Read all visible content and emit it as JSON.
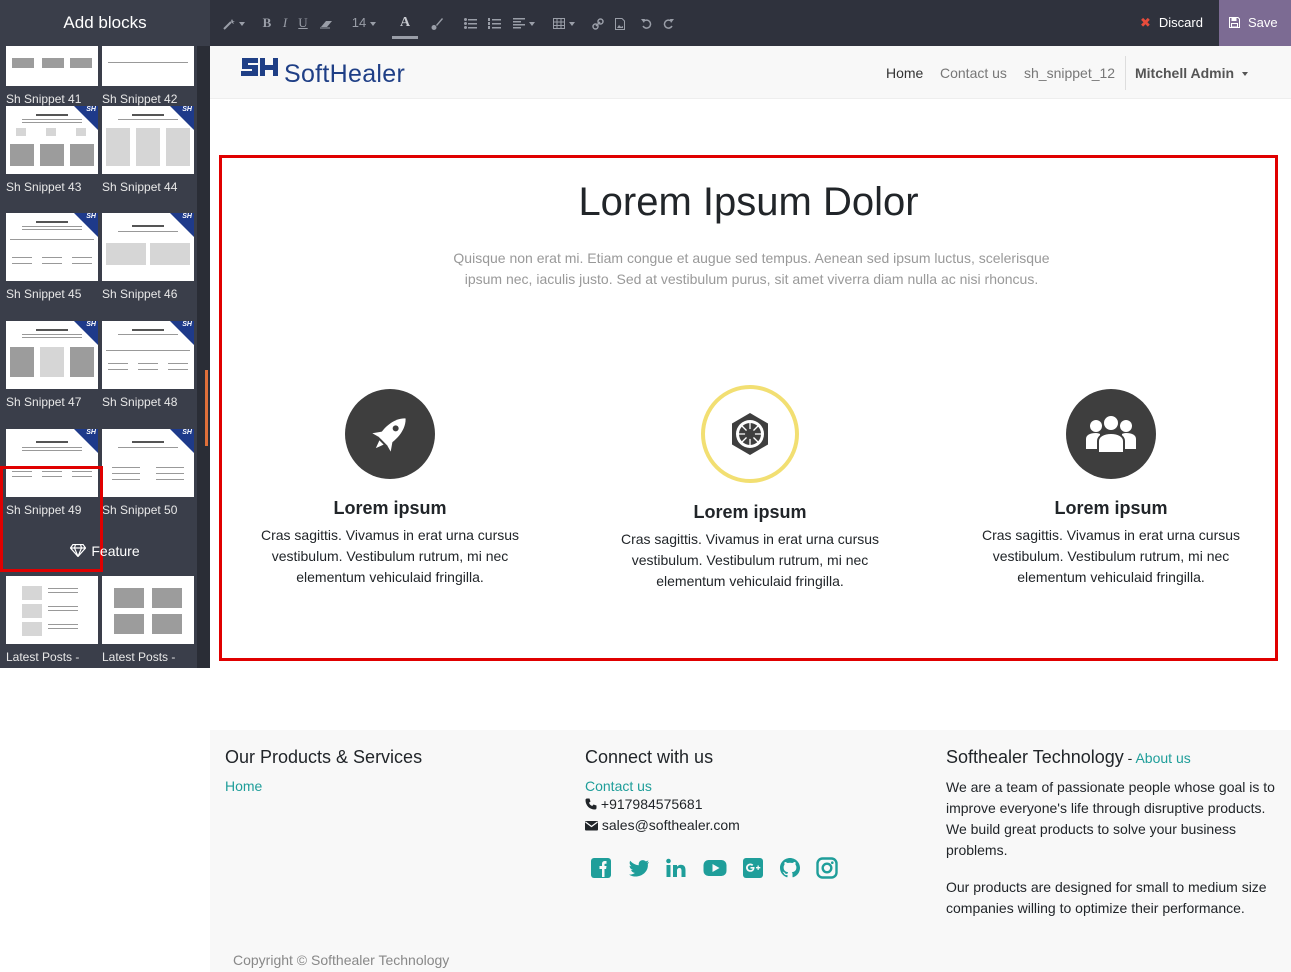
{
  "editor": {
    "panel_title": "Add blocks",
    "font_size": "14",
    "discard_label": "Discard",
    "save_label": "Save"
  },
  "panel": {
    "snippets": [
      {
        "label": "Sh Snippet 41"
      },
      {
        "label": "Sh Snippet 42"
      },
      {
        "label": "Sh Snippet 43"
      },
      {
        "label": "Sh Snippet 44"
      },
      {
        "label": "Sh Snippet 45"
      },
      {
        "label": "Sh Snippet 46"
      },
      {
        "label": "Sh Snippet 47"
      },
      {
        "label": "Sh Snippet 48"
      },
      {
        "label": "Sh Snippet 49"
      },
      {
        "label": "Sh Snippet 50"
      }
    ],
    "badge_text": "SH",
    "feature_heading": "Feature",
    "feature_items": [
      {
        "label": "Latest Posts -"
      },
      {
        "label": "Latest Posts -"
      }
    ]
  },
  "nav": {
    "logo_text": "SoftHealer",
    "links": [
      {
        "label": "Home"
      },
      {
        "label": "Contact us"
      },
      {
        "label": "sh_snippet_12"
      }
    ],
    "user": "Mitchell Admin"
  },
  "section": {
    "title": "Lorem Ipsum Dolor",
    "subtitle": "Quisque non erat mi. Etiam congue et augue sed tempus. Aenean sed ipsum luctus, scelerisque ipsum nec, iaculis justo. Sed at vestibulum purus, sit amet viverra diam nulla ac nisi rhoncus.",
    "features": [
      {
        "icon": "rocket-icon",
        "title": "Lorem ipsum",
        "text": "Cras sagittis. Vivamus in erat urna cursus vestibulum. Vestibulum rutrum, mi nec elementum vehiculaid fringilla."
      },
      {
        "icon": "empire-icon",
        "title": "Lorem ipsum",
        "text": "Cras sagittis. Vivamus in erat urna cursus vestibulum. Vestibulum rutrum, mi nec elementum vehiculaid fringilla."
      },
      {
        "icon": "users-icon",
        "title": "Lorem ipsum",
        "text": "Cras sagittis. Vivamus in erat urna cursus vestibulum. Vestibulum rutrum, mi nec elementum vehiculaid fringilla."
      }
    ]
  },
  "footer": {
    "products_heading": "Our Products & Services",
    "products_link": "Home",
    "connect_heading": "Connect with us",
    "contact_link": "Contact us",
    "phone": "+917984575681",
    "email": "sales@softhealer.com",
    "company_heading": "Softhealer Technology",
    "company_sep": " - ",
    "about_link": "About us",
    "about_p1": "We are a team of passionate people whose goal is to improve everyone's life through disruptive products. We build great products to solve your business problems.",
    "about_p2": "Our products are designed for small to medium size companies willing to optimize their performance.",
    "copyright": "Copyright © Softhealer Technology"
  },
  "colors": {
    "accent_teal": "#1f9e9a",
    "save_purple": "#7c6b93",
    "highlight_red": "#e00000",
    "logo_blue": "#1f3f86"
  }
}
